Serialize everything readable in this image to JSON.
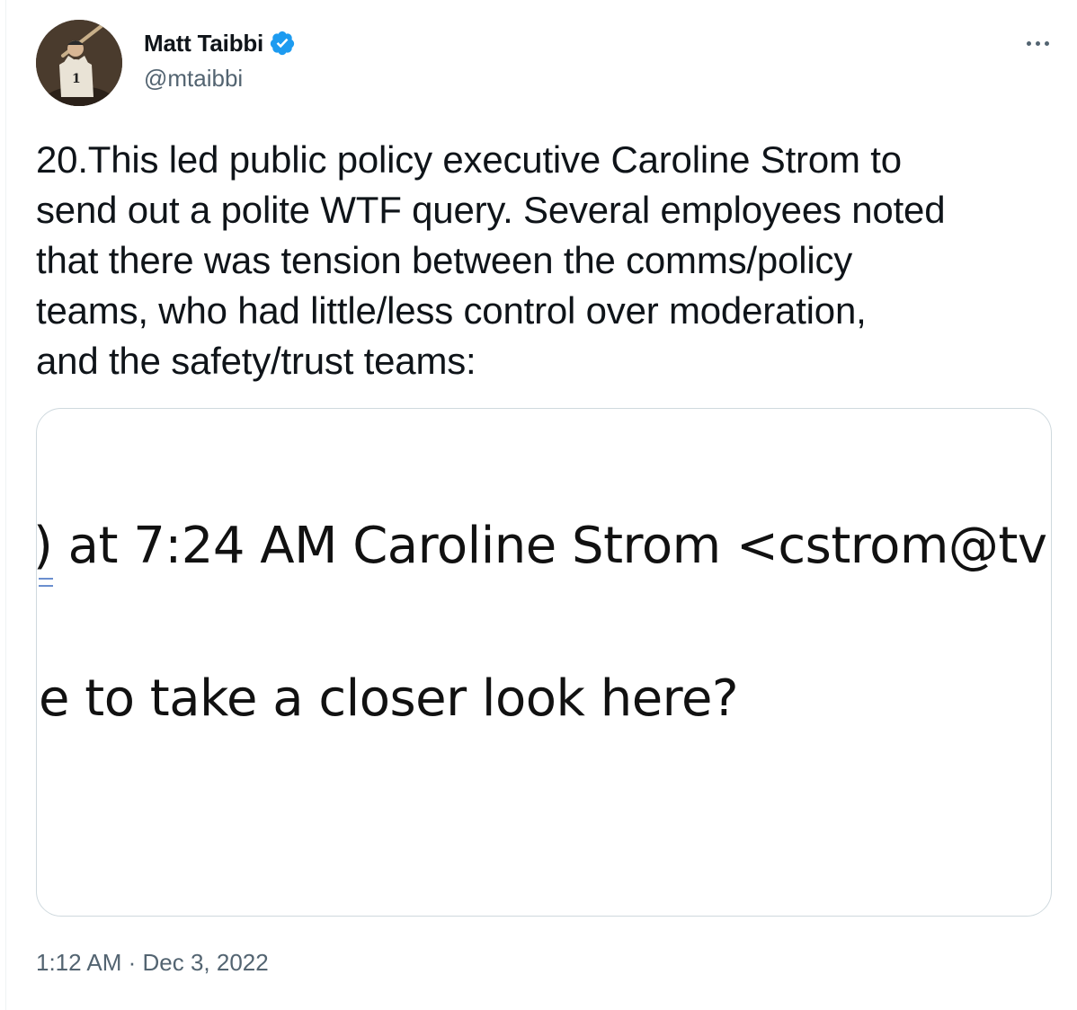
{
  "author": {
    "name": "Matt Taibbi",
    "handle": "@mtaibbi",
    "verified": true,
    "avatar_icon": "avatar-photo-baseball-player"
  },
  "tweet": {
    "text": "20.This led public policy executive Caroline Strom to\nsend out a polite WTF query. Several employees noted\nthat there was tension between the comms/policy\nteams, who had little/less control over moderation,\nand the safety/trust teams:",
    "timestamp": "1:12 AM · Dec 3, 2022"
  },
  "media": {
    "lines": [
      ") at 7:24 AM Caroline Strom <cstrom@tv",
      "e to take a closer look here?"
    ]
  },
  "colors": {
    "text": "#0f1419",
    "secondary": "#536471",
    "border": "#cfd9de",
    "verified_blue": "#1d9bf0"
  },
  "icons": {
    "more": "more-dots-icon",
    "verified": "verified-badge-icon"
  }
}
